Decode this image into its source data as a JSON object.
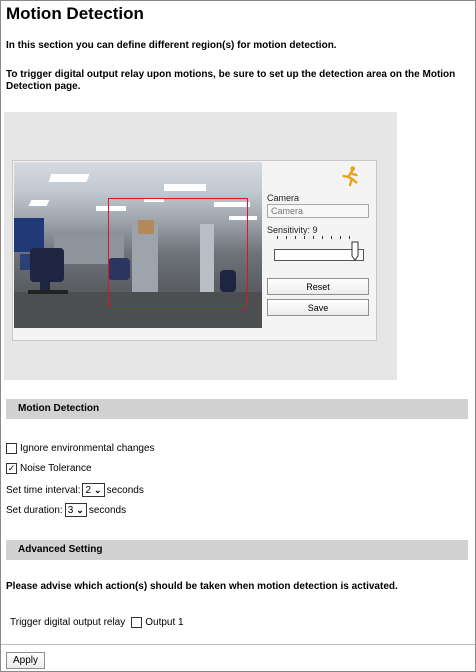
{
  "page": {
    "title": "Motion Detection",
    "intro1": "In this section you can define different region(s) for motion detection.",
    "intro2": "To trigger digital output relay upon motions, be sure to set up the detection area on the Motion Detection page."
  },
  "viewer": {
    "camera_label": "Camera",
    "camera_input_placeholder": "Camera",
    "sensitivity_label": "Sensitivity: 9",
    "sensitivity_value": 9,
    "sensitivity_max": 10,
    "reset_label": "Reset",
    "save_label": "Save",
    "icon": "running-man-icon",
    "region_color": "#e0141c"
  },
  "motion_section": {
    "header": "Motion Detection",
    "ignore_label": "Ignore environmental changes",
    "ignore_checked": false,
    "noise_label": "Noise Tolerance",
    "noise_checked": true,
    "interval_label": "Set time interval:",
    "interval_value": "2",
    "interval_unit": "seconds",
    "duration_label": "Set duration:",
    "duration_value": "3",
    "duration_unit": "seconds"
  },
  "advanced_section": {
    "header": "Advanced Setting",
    "prompt": "Please advise which action(s) should be taken when motion detection is activated.",
    "trigger_label": "Trigger digital output relay",
    "output_label": "Output 1",
    "output_checked": false
  },
  "footer": {
    "apply_label": "Apply"
  }
}
